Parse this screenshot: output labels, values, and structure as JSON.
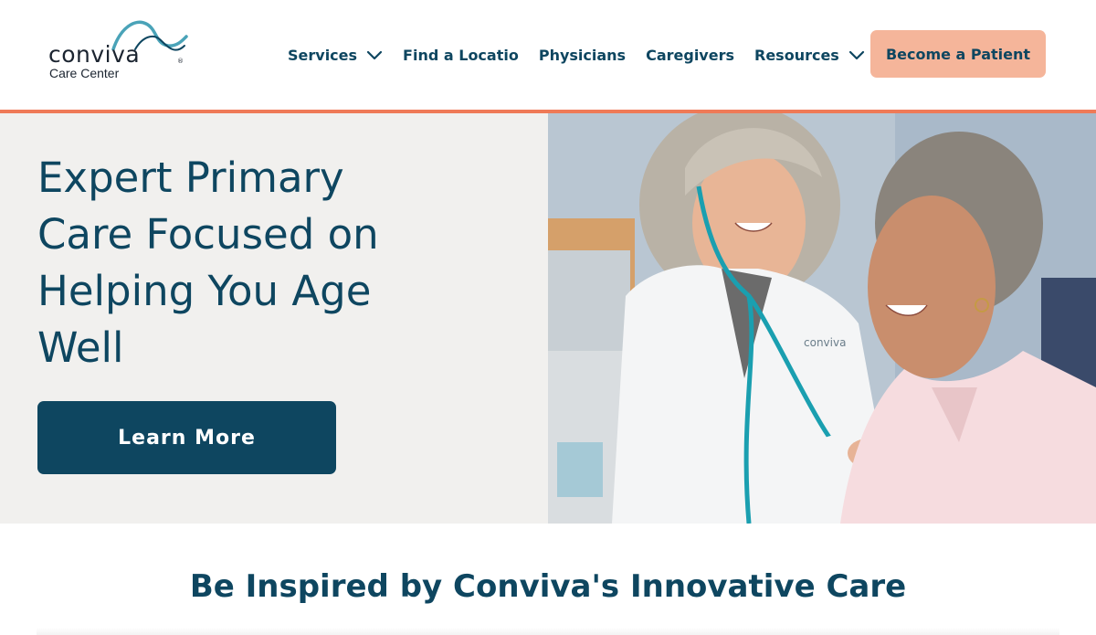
{
  "brand": {
    "name": "conviva",
    "subtitle": "Care Center",
    "registered": "®"
  },
  "nav": {
    "items": [
      {
        "label": "Services",
        "has_dropdown": true
      },
      {
        "label": "Find a Locatio",
        "has_dropdown": false
      },
      {
        "label": "Physicians",
        "has_dropdown": false
      },
      {
        "label": "Caregivers",
        "has_dropdown": false
      },
      {
        "label": "Resources",
        "has_dropdown": true
      }
    ],
    "cta_label": "Become a Patient"
  },
  "hero": {
    "title": "Expert Primary Care Focused on Helping You Age Well",
    "button_label": "Learn More",
    "coat_logo_text": "conviva"
  },
  "section": {
    "title": "Be Inspired by Conviva's Innovative Care"
  },
  "colors": {
    "primary": "#0e4660",
    "accent_orange": "#ef7a57",
    "cta_peach": "#f5b59a",
    "hero_bg": "#f1f0ee",
    "logo_teal": "#4aa3b8"
  },
  "icons": {
    "dropdown": "chevron-down-icon",
    "logo": "conviva-wave-logo"
  }
}
